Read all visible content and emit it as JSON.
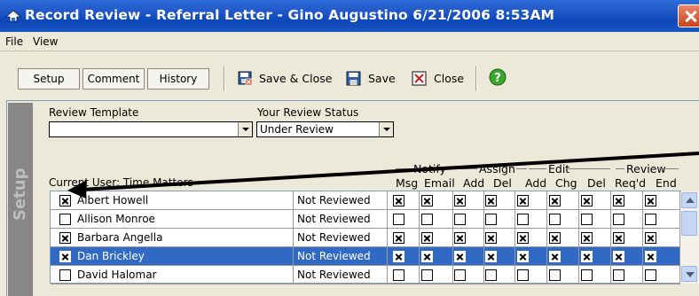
{
  "window": {
    "title": "Record Review - Referral Letter - Gino Augustino   6/21/2006   8:53AM",
    "close_icon": "close-icon"
  },
  "menu": {
    "file": "File",
    "view": "View"
  },
  "toolbar": {
    "tab_setup": "Setup",
    "tab_comment": "Comment",
    "tab_history": "History",
    "save_close": "Save & Close",
    "save": "Save",
    "close": "Close",
    "help_icon": "help-icon"
  },
  "side": {
    "label": "Setup"
  },
  "form": {
    "review_template_label": "Review Template",
    "review_template_value": "",
    "review_status_label": "Your Review Status",
    "review_status_value": "Under Review",
    "current_user_label": "Current User: Time Matters"
  },
  "columns": {
    "groups": [
      "Notify",
      "Assign",
      "Edit",
      "Review"
    ],
    "headers": [
      "Msg",
      "Email",
      "Add",
      "Del",
      "Add",
      "Chg",
      "Del",
      "Req'd",
      "End"
    ]
  },
  "rows": [
    {
      "name": "Albert Howell",
      "checked": true,
      "status": "Not Reviewed",
      "flags": [
        true,
        true,
        true,
        true,
        true,
        true,
        true,
        true,
        true
      ],
      "selected": false
    },
    {
      "name": "Allison Monroe",
      "checked": false,
      "status": "Not Reviewed",
      "flags": [
        false,
        false,
        false,
        false,
        false,
        false,
        false,
        false,
        false
      ],
      "selected": false
    },
    {
      "name": "Barbara Angella",
      "checked": true,
      "status": "Not Reviewed",
      "flags": [
        true,
        true,
        true,
        true,
        true,
        true,
        true,
        true,
        true
      ],
      "selected": false
    },
    {
      "name": "Dan Brickley",
      "checked": true,
      "status": "Not Reviewed",
      "flags": [
        true,
        true,
        true,
        true,
        true,
        true,
        true,
        true,
        true
      ],
      "selected": true
    },
    {
      "name": "David Halomar",
      "checked": false,
      "status": "Not Reviewed",
      "flags": [
        false,
        false,
        false,
        false,
        false,
        false,
        false,
        false,
        false
      ],
      "selected": false
    }
  ]
}
